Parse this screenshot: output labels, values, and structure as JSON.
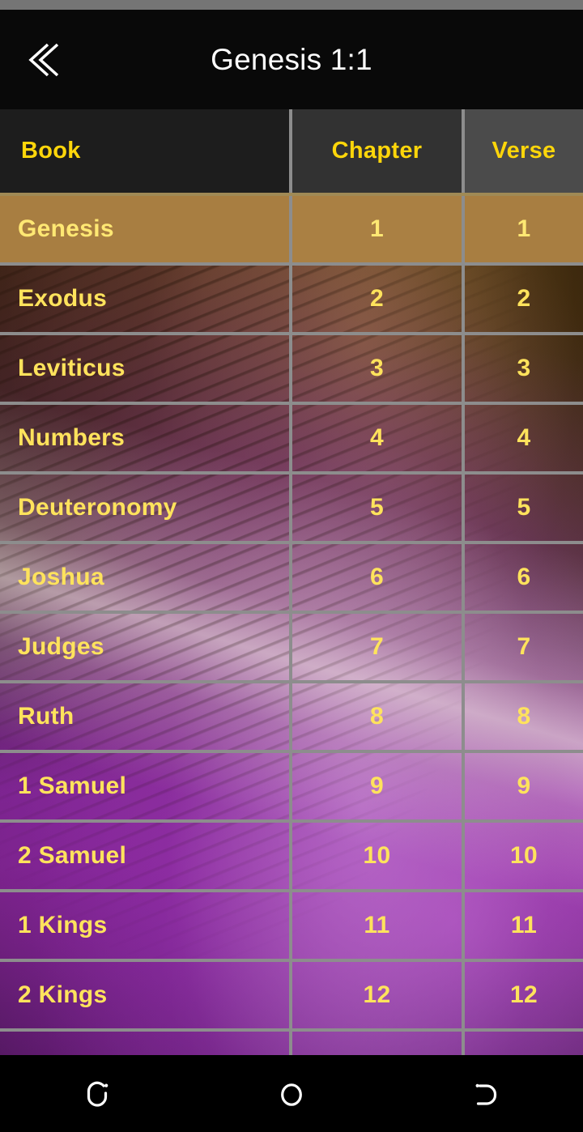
{
  "app": {
    "title": "Genesis 1:1",
    "back_icon": "double-chevron-left-icon"
  },
  "table": {
    "headers": {
      "book": "Book",
      "chapter": "Chapter",
      "verse": "Verse"
    },
    "selected_index": 0,
    "rows": [
      {
        "book": "Genesis",
        "chapter": "1",
        "verse": "1"
      },
      {
        "book": "Exodus",
        "chapter": "2",
        "verse": "2"
      },
      {
        "book": "Leviticus",
        "chapter": "3",
        "verse": "3"
      },
      {
        "book": "Numbers",
        "chapter": "4",
        "verse": "4"
      },
      {
        "book": "Deuteronomy",
        "chapter": "5",
        "verse": "5"
      },
      {
        "book": "Joshua",
        "chapter": "6",
        "verse": "6"
      },
      {
        "book": "Judges",
        "chapter": "7",
        "verse": "7"
      },
      {
        "book": "Ruth",
        "chapter": "8",
        "verse": "8"
      },
      {
        "book": "1 Samuel",
        "chapter": "9",
        "verse": "9"
      },
      {
        "book": "2 Samuel",
        "chapter": "10",
        "verse": "10"
      },
      {
        "book": "1 Kings",
        "chapter": "11",
        "verse": "11"
      },
      {
        "book": "2 Kings",
        "chapter": "12",
        "verse": "12"
      }
    ]
  },
  "nav": {
    "recents_label": "recents-icon",
    "home_label": "home-icon",
    "back_label": "back-icon"
  },
  "colors": {
    "accent_yellow": "#ffd60a",
    "row_text_yellow": "#ffe35c",
    "selected_row": "#a87e41",
    "grid_line": "#8d8d8d",
    "app_bar": "#090909",
    "status_bar": "#757575"
  }
}
